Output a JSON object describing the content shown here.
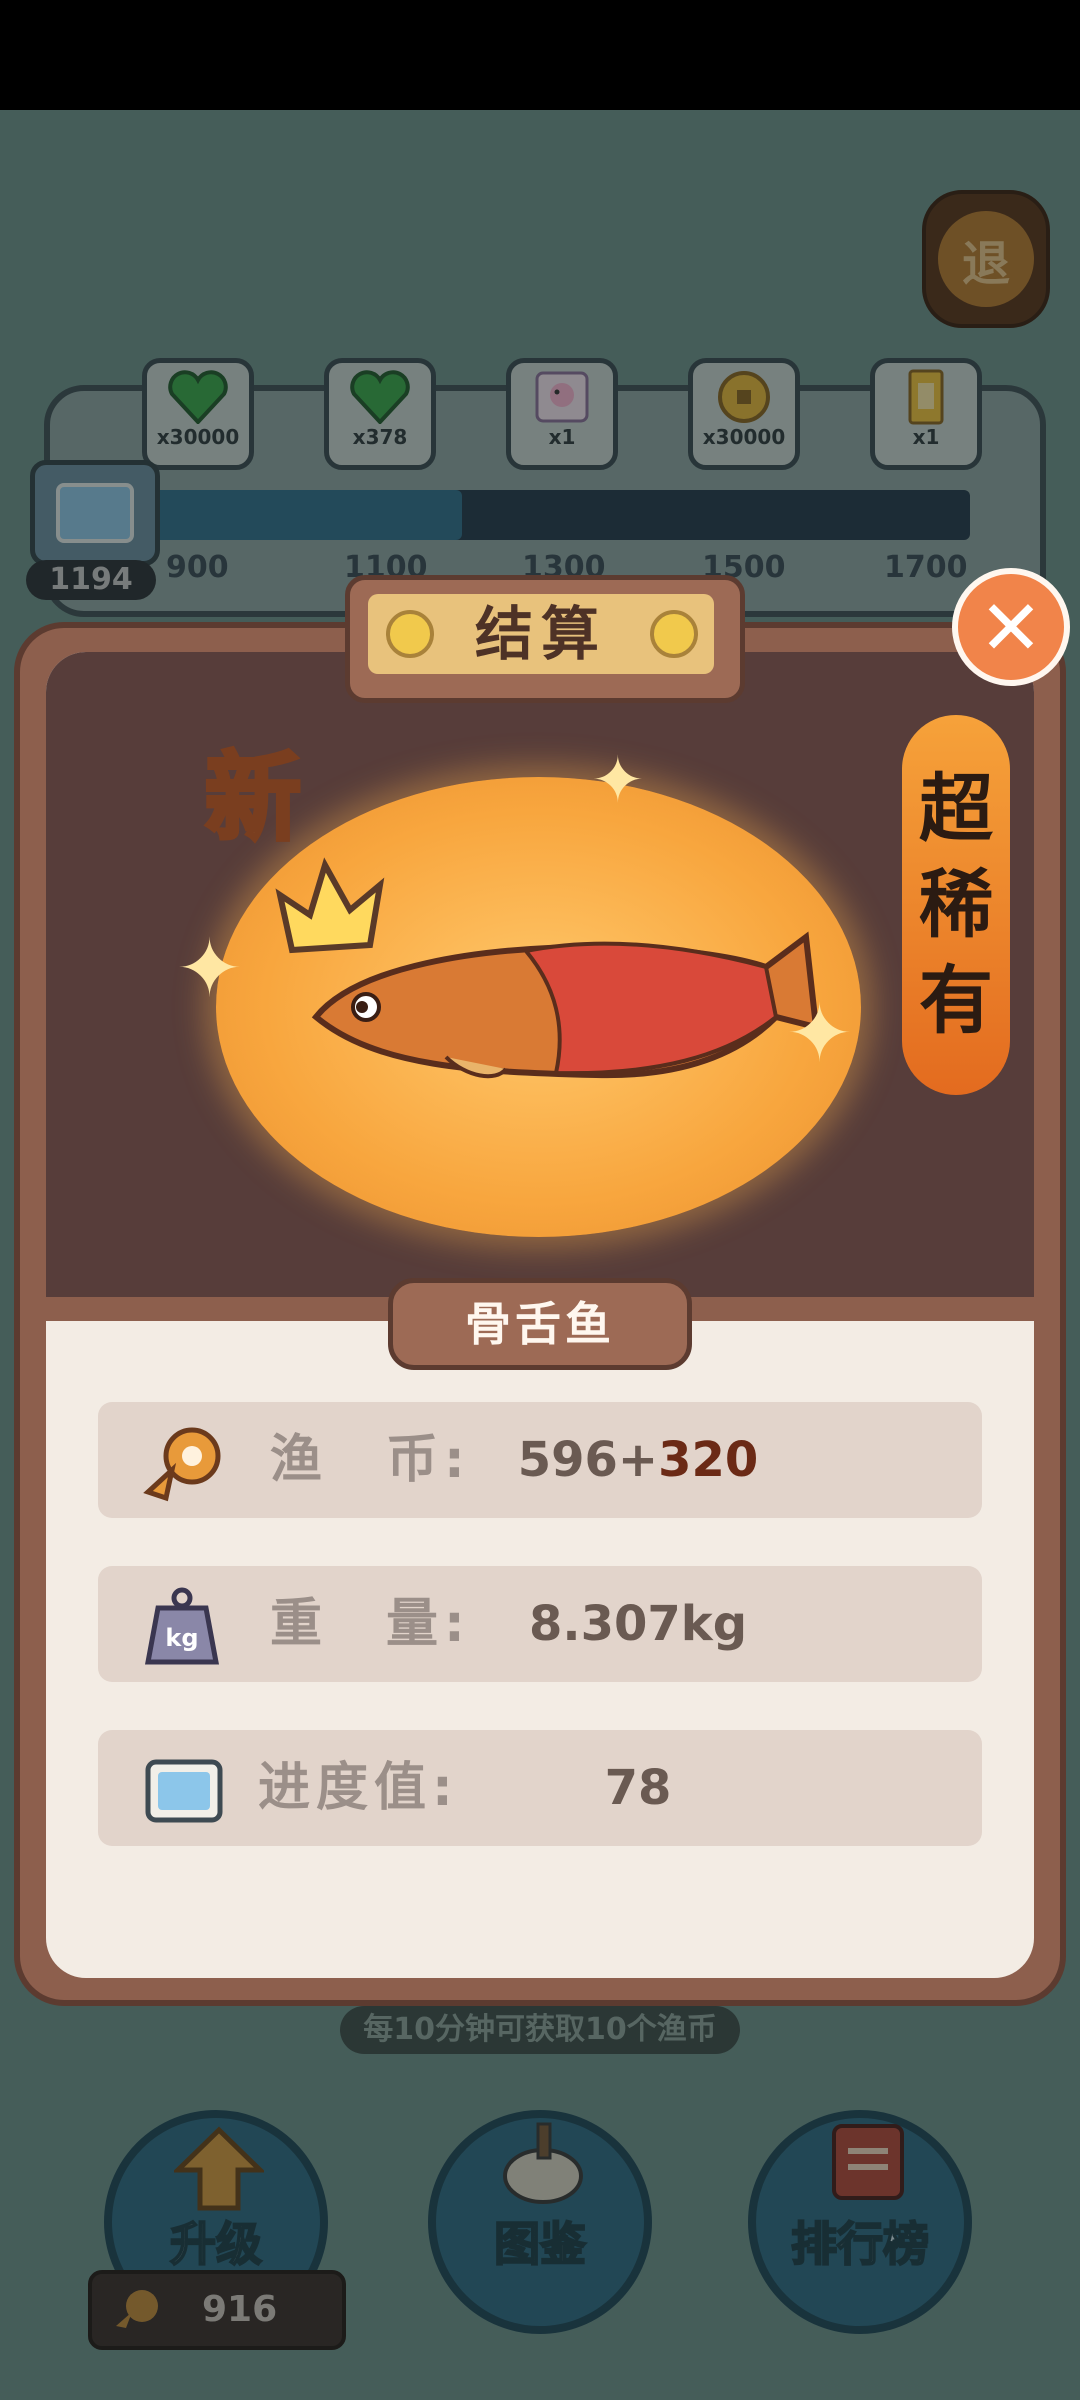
{
  "exit_button": {
    "label": "退"
  },
  "reward_track": {
    "rewards": [
      {
        "icon": "green-heart-icon",
        "count": "x30000"
      },
      {
        "icon": "green-heart-icon",
        "count": "x378"
      },
      {
        "icon": "pony-card-icon",
        "count": "x1"
      },
      {
        "icon": "gold-coin-icon",
        "count": "x30000"
      },
      {
        "icon": "gold-ticket-icon",
        "count": "x1"
      }
    ],
    "ticks": [
      "900",
      "1100",
      "1300",
      "1500",
      "1700"
    ],
    "progress_value": "1194",
    "progress_fraction": 0.38
  },
  "result_dialog": {
    "title": "结算",
    "new_badge": "新",
    "rarity": [
      "超",
      "稀",
      "有"
    ],
    "fish_name": "骨舌鱼",
    "stats": [
      {
        "icon": "fish-coin-icon",
        "label": "渔　币:",
        "base": "596",
        "plus": "+",
        "bonus": "320"
      },
      {
        "icon": "weight-kg-icon",
        "label": "重　量:",
        "value": "8.307kg"
      },
      {
        "icon": "progress-card-icon",
        "label": "进度值:",
        "value": "78"
      }
    ]
  },
  "hint": "每10分钟可获取10个渔币",
  "bottom_nav": {
    "upgrade": "升级",
    "collection": "图鉴",
    "leaderboard": "排行榜",
    "coins": "916"
  },
  "colors": {
    "accent": "#f1844a",
    "panel": "#8d5f4d",
    "glow": "#f8a63e",
    "rarity": "#e36b1f"
  }
}
